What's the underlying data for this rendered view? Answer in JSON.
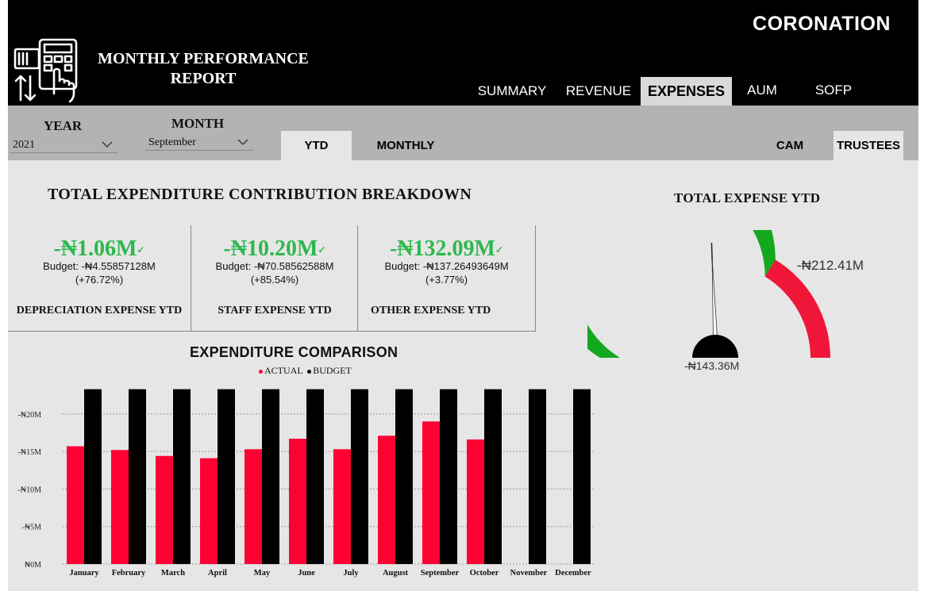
{
  "header": {
    "title_line1": "MONTHLY PERFORMANCE",
    "title_line2": "REPORT",
    "brand": "CORONATION",
    "nav": [
      {
        "label": "SUMMARY",
        "active": false
      },
      {
        "label": "REVENUE",
        "active": false
      },
      {
        "label": "EXPENSES",
        "active": true
      },
      {
        "label": "AUM",
        "active": false
      },
      {
        "label": "SOFP",
        "active": false
      }
    ]
  },
  "filters": {
    "year_label": "YEAR",
    "year_value": "2021",
    "month_label": "MONTH",
    "month_value": "September",
    "period_tabs": [
      {
        "label": "YTD",
        "active": true
      },
      {
        "label": "MONTHLY",
        "active": false
      }
    ],
    "entity_tabs": [
      {
        "label": "CAM",
        "active": false
      },
      {
        "label": "TRUSTEES",
        "active": true
      }
    ]
  },
  "breakdown": {
    "title": "TOTAL EXPENDITURE CONTRIBUTION BREAKDOWN",
    "kpis": [
      {
        "value": "-₦1.06M",
        "budget": "Budget: -₦4.55857128M",
        "variance": "(+76.72%)",
        "label": "DEPRECIATION EXPENSE YTD"
      },
      {
        "value": "-₦10.20M",
        "budget": "Budget: -₦70.58562588M",
        "variance": "(+85.54%)",
        "label": "STAFF EXPENSE YTD"
      },
      {
        "value": "-₦132.09M",
        "budget": "Budget: -₦137.26493649M",
        "variance": "(+3.77%)",
        "label": "OTHER EXPENSE YTD"
      }
    ],
    "tick_glyph": "✓"
  },
  "gauge": {
    "title": "TOTAL EXPENSE YTD",
    "max_label": "-₦212.41M",
    "value_label": "-₦143.36M",
    "value_fraction": 0.675,
    "target_fraction": 0.49,
    "colors": {
      "good": "#14a81e",
      "bad": "#f0163a",
      "needle": "#000000"
    }
  },
  "chart_data": {
    "type": "bar",
    "title": "EXPENDITURE COMPARISON",
    "legend_position": "top",
    "categories": [
      "January",
      "February",
      "March",
      "April",
      "May",
      "June",
      "July",
      "August",
      "September",
      "October",
      "November",
      "December"
    ],
    "series": [
      {
        "name": "ACTUAL",
        "color": "#ff0033",
        "values": [
          15.7,
          15.2,
          14.4,
          14.1,
          15.3,
          16.7,
          15.3,
          17.1,
          19.0,
          16.6,
          null,
          null
        ]
      },
      {
        "name": "BUDGET",
        "color": "#000000",
        "values": [
          23.3,
          23.3,
          23.3,
          23.3,
          23.3,
          23.3,
          23.3,
          23.3,
          23.3,
          23.3,
          23.3,
          23.3
        ]
      }
    ],
    "y_ticks": [
      {
        "value": 0,
        "label": "₦0M"
      },
      {
        "value": 5,
        "label": "-₦5M"
      },
      {
        "value": 10,
        "label": "-₦10M"
      },
      {
        "value": 15,
        "label": "-₦15M"
      },
      {
        "value": 20,
        "label": "-₦20M"
      }
    ],
    "ylim": [
      0,
      24
    ],
    "grid": true
  }
}
